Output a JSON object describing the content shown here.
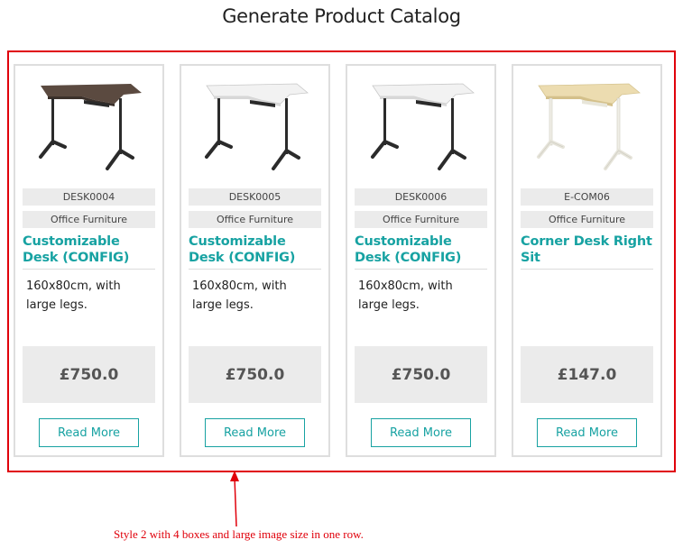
{
  "page": {
    "title": "Generate Product Catalog"
  },
  "products": [
    {
      "image": "desk-dark-walnut",
      "sku": "DESK0004",
      "category": "Office Furniture",
      "title": "Customizable Desk (CONFIG)",
      "description": "160x80cm, with large legs.",
      "price": "£750.0",
      "button_label": "Read More"
    },
    {
      "image": "desk-white-black-legs",
      "sku": "DESK0005",
      "category": "Office Furniture",
      "title": "Customizable Desk (CONFIG)",
      "description": "160x80cm, with large legs.",
      "price": "£750.0",
      "button_label": "Read More"
    },
    {
      "image": "desk-white-black-legs",
      "sku": "DESK0006",
      "category": "Office Furniture",
      "title": "Customizable Desk (CONFIG)",
      "description": "160x80cm, with large legs.",
      "price": "£750.0",
      "button_label": "Read More"
    },
    {
      "image": "desk-birch-white-legs",
      "sku": "E-COM06",
      "category": "Office Furniture",
      "title": "Corner Desk Right Sit",
      "description": "",
      "price": "£147.0",
      "button_label": "Read More"
    }
  ],
  "annotation": {
    "text": "Style 2 with 4 boxes and large image size in one row."
  },
  "colors": {
    "accent": "#17a2a2",
    "highlight": "#e0000b",
    "badge_bg": "#ebebeb",
    "border": "#dedede"
  }
}
